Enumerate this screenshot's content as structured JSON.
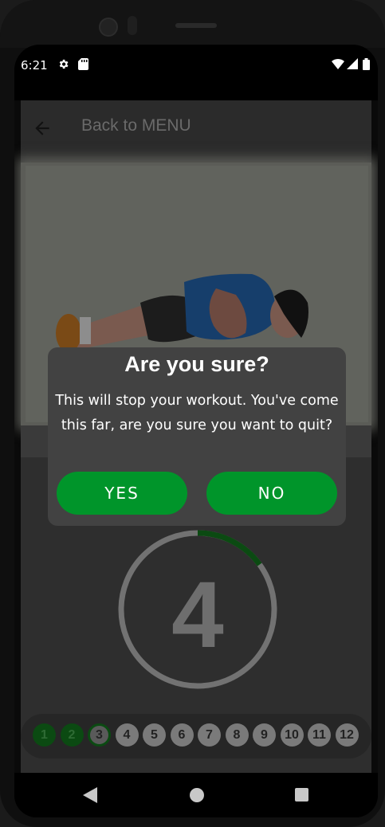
{
  "status": {
    "time": "6:21",
    "icons": [
      "settings-icon",
      "sd-card-icon",
      "wifi-icon",
      "signal-icon",
      "battery-icon"
    ]
  },
  "toolbar": {
    "back_icon": "arrow-back-icon",
    "title": "Back to MENU"
  },
  "workout": {
    "timer_value": "4",
    "timer_progress": 0.15,
    "accent": "#0b4a12",
    "steps": [
      {
        "label": "1",
        "state": "done"
      },
      {
        "label": "2",
        "state": "done"
      },
      {
        "label": "3",
        "state": "current"
      },
      {
        "label": "4",
        "state": "todo"
      },
      {
        "label": "5",
        "state": "todo"
      },
      {
        "label": "6",
        "state": "todo"
      },
      {
        "label": "7",
        "state": "todo"
      },
      {
        "label": "8",
        "state": "todo"
      },
      {
        "label": "9",
        "state": "todo"
      },
      {
        "label": "10",
        "state": "todo"
      },
      {
        "label": "11",
        "state": "todo"
      },
      {
        "label": "12",
        "state": "todo"
      }
    ]
  },
  "dialog": {
    "title": "Are you sure?",
    "message": "This will stop your workout. You've come this far, are you sure you want to quit?",
    "yes_label": "YES",
    "no_label": "NO",
    "button_color": "#00952a"
  },
  "navbar": {
    "back_icon": "nav-back-icon",
    "home_icon": "nav-home-icon",
    "recents_icon": "nav-recents-icon"
  }
}
